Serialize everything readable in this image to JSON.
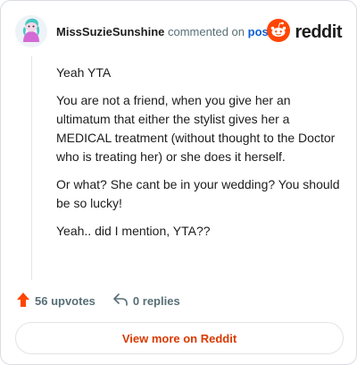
{
  "header": {
    "username": "MissSuzieSunshine",
    "action_text": "commented on",
    "post_link": "post",
    "brand": "reddit"
  },
  "comment": {
    "paragraphs": [
      "Yeah YTA",
      "You are not a friend, when you give her an ultimatum that either the stylist gives her a MEDICAL treatment (without thought to the Doctor who is treating her) or she does it herself.",
      "Or what? She cant be in your wedding? You should be so lucky!",
      "Yeah.. did I mention, YTA??"
    ]
  },
  "actions": {
    "upvotes": "56 upvotes",
    "replies": "0 replies"
  },
  "footer": {
    "view_more": "View more on Reddit"
  },
  "colors": {
    "reddit_orange": "#ff4500",
    "link_blue": "#0b5fd6",
    "view_more_text": "#d93a00"
  },
  "icons": {
    "avatar": "avatar-icon",
    "brand": "reddit-logo-icon",
    "upvote": "upvote-arrow-icon",
    "reply": "reply-arrow-icon"
  }
}
